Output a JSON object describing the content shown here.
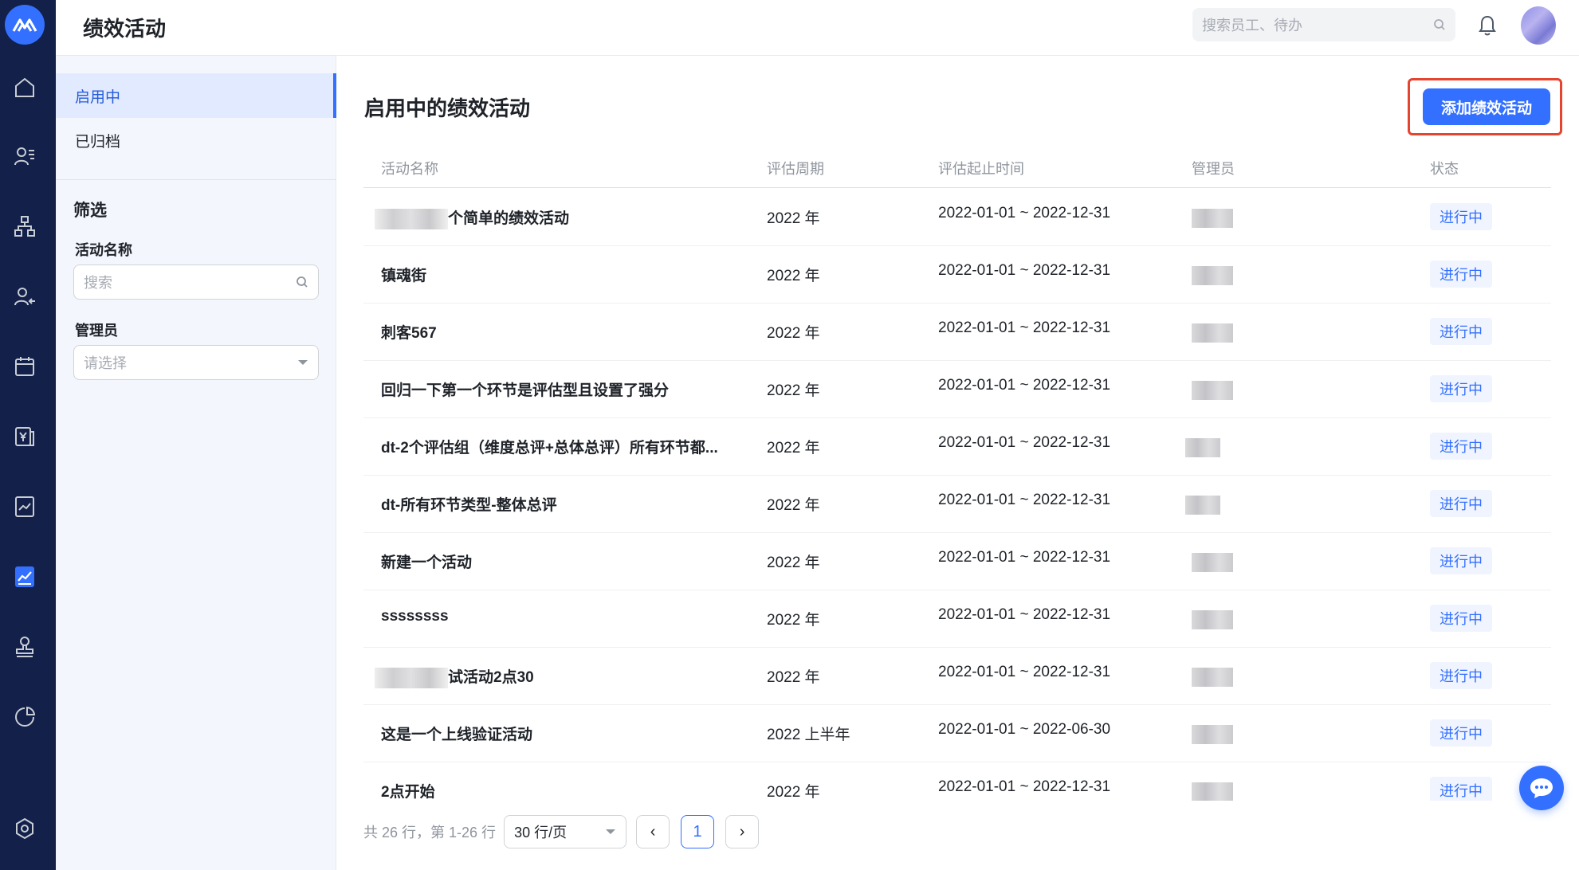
{
  "app": {
    "title": "绩效活动"
  },
  "header": {
    "search_placeholder": "搜索员工、待办"
  },
  "rail": {
    "icons": [
      "home-icon",
      "employee-list-icon",
      "org-chart-icon",
      "user-transfer-icon",
      "calendar-icon",
      "salary-icon",
      "report-icon",
      "performance-icon",
      "stamp-icon",
      "pie-chart-icon",
      "settings-icon"
    ],
    "active": "performance-icon"
  },
  "sidebar": {
    "items": [
      {
        "label": "启用中",
        "active": true
      },
      {
        "label": "已归档",
        "active": false
      }
    ],
    "filter_title": "筛选",
    "name_label": "活动名称",
    "name_placeholder": "搜索",
    "admin_label": "管理员",
    "admin_placeholder": "请选择"
  },
  "main": {
    "title": "启用中的绩效活动",
    "add_button": "添加绩效活动",
    "columns": [
      "活动名称",
      "评估周期",
      "评估起止时间",
      "管理员",
      "状态"
    ],
    "rows": [
      {
        "name": "个简单的绩效活动",
        "name_redacted_prefix": true,
        "period": "2022 年",
        "range": "2022-01-01 ~ 2022-12-31",
        "status": "进行中"
      },
      {
        "name": "镇魂街",
        "period": "2022 年",
        "range": "2022-01-01 ~ 2022-12-31",
        "status": "进行中"
      },
      {
        "name": "刺客567",
        "period": "2022 年",
        "range": "2022-01-01 ~ 2022-12-31",
        "status": "进行中"
      },
      {
        "name": "回归一下第一个环节是评估型且设置了强分",
        "period": "2022 年",
        "range": "2022-01-01 ~ 2022-12-31",
        "status": "进行中"
      },
      {
        "name": "dt-2个评估组（维度总评+总体总评）所有环节都...",
        "period": "2022 年",
        "range": "2022-01-01 ~ 2022-12-31",
        "status": "进行中"
      },
      {
        "name": "dt-所有环节类型-整体总评",
        "period": "2022 年",
        "range": "2022-01-01 ~ 2022-12-31",
        "status": "进行中"
      },
      {
        "name": "新建一个活动",
        "period": "2022 年",
        "range": "2022-01-01 ~ 2022-12-31",
        "status": "进行中"
      },
      {
        "name": "ssssssss",
        "period": "2022 年",
        "range": "2022-01-01 ~ 2022-12-31",
        "status": "进行中"
      },
      {
        "name": "试活动2点30",
        "name_redacted_prefix": true,
        "period": "2022 年",
        "range": "2022-01-01 ~ 2022-12-31",
        "status": "进行中"
      },
      {
        "name": "这是一个上线验证活动",
        "period": "2022 上半年",
        "range": "2022-01-01 ~ 2022-06-30",
        "status": "进行中"
      },
      {
        "name": "2点开始",
        "period": "2022 年",
        "range": "2022-01-01 ~ 2022-12-31",
        "status": "进行中"
      }
    ],
    "pagination": {
      "total_text": "共 26 行，第 1-26 行",
      "page_size": "30 行/页",
      "prev": "‹",
      "current": "1",
      "next": "›"
    }
  },
  "colors": {
    "accent": "#3370ff",
    "rail_bg": "#12204a",
    "highlight_border": "#e5442f"
  }
}
